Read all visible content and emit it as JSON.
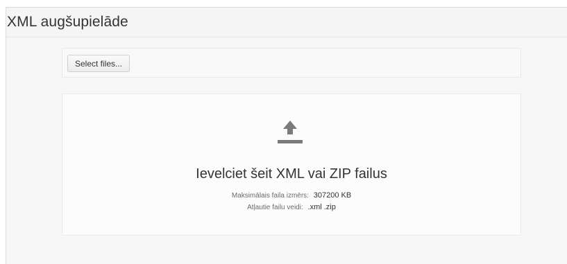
{
  "header": {
    "title": "XML augšupielāde"
  },
  "select_button": {
    "label": "Select files..."
  },
  "drop_zone": {
    "icon": "upload-icon",
    "title": "Ievelciet šeit XML vai ZIP failus",
    "max_size_label": "Maksimālais faila izmērs:",
    "max_size_value": "307200 KB",
    "allowed_types_label": "Atļautie failu veidi:",
    "allowed_types_value": ".xml .zip"
  },
  "colors": {
    "icon": "#7a7a7a",
    "text": "#333333"
  }
}
